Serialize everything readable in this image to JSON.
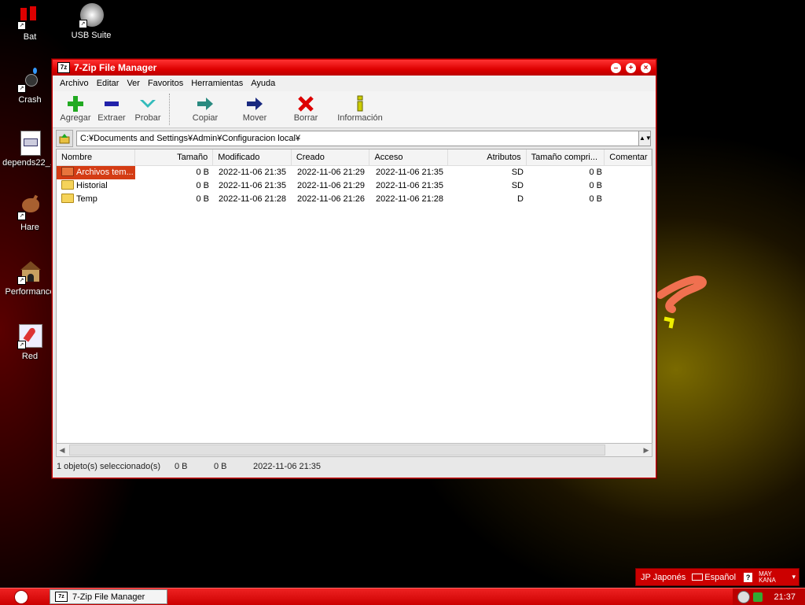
{
  "desktop": {
    "icons": [
      {
        "label": "Bat"
      },
      {
        "label": "USB Suite"
      },
      {
        "label": "Crash"
      },
      {
        "label": "depends22_..."
      },
      {
        "label": "Hare"
      },
      {
        "label": "Performance"
      },
      {
        "label": "Red"
      }
    ]
  },
  "window": {
    "app_icon": "7z",
    "title": "7-Zip File Manager",
    "menu": [
      "Archivo",
      "Editar",
      "Ver",
      "Favoritos",
      "Herramientas",
      "Ayuda"
    ],
    "toolbar": [
      {
        "label": "Agregar",
        "icon": "add-icon"
      },
      {
        "label": "Extraer",
        "icon": "extract-icon"
      },
      {
        "label": "Probar",
        "icon": "test-icon"
      },
      {
        "label": "Copiar",
        "icon": "copy-icon"
      },
      {
        "label": "Mover",
        "icon": "move-icon"
      },
      {
        "label": "Borrar",
        "icon": "delete-icon"
      },
      {
        "label": "Información",
        "icon": "info-icon"
      }
    ],
    "address": "C:¥Documents and Settings¥Admin¥Configuracion local¥",
    "columns": [
      "Nombre",
      "Tamaño",
      "Modificado",
      "Creado",
      "Acceso",
      "Atributos",
      "Tamaño compri...",
      "Comentar"
    ],
    "rows": [
      {
        "name": "Archivos tem...",
        "size": "0 B",
        "modified": "2022-11-06 21:35",
        "created": "2022-11-06 21:29",
        "accessed": "2022-11-06 21:35",
        "attributes": "SD",
        "packed": "0 B",
        "selected": true
      },
      {
        "name": "Historial",
        "size": "0 B",
        "modified": "2022-11-06 21:35",
        "created": "2022-11-06 21:29",
        "accessed": "2022-11-06 21:35",
        "attributes": "SD",
        "packed": "0 B",
        "selected": false
      },
      {
        "name": "Temp",
        "size": "0 B",
        "modified": "2022-11-06 21:28",
        "created": "2022-11-06 21:26",
        "accessed": "2022-11-06 21:28",
        "attributes": "D",
        "packed": "0 B",
        "selected": false
      }
    ],
    "status": {
      "selection": "1 objeto(s) seleccionado(s)",
      "size": "0 B",
      "packed": "0 B",
      "date": "2022-11-06 21:35"
    }
  },
  "langbar": {
    "input_lang": "JP Japonés",
    "keyboard": "Español",
    "mode_top": "MAY",
    "mode_bottom": "KANA"
  },
  "taskbar": {
    "task_label": "7-Zip File Manager",
    "clock": "21:37"
  },
  "colors": {
    "accent": "#d00000",
    "selection": "#d43c14"
  }
}
